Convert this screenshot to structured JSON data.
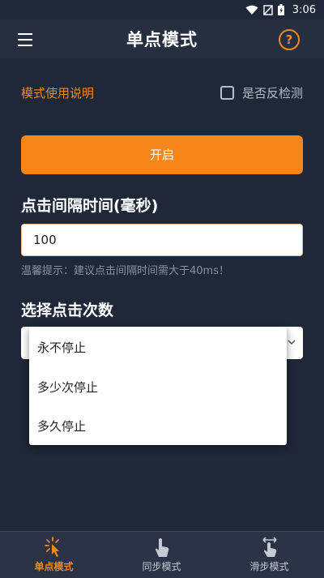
{
  "status_bar": {
    "time": "3:06"
  },
  "app_bar": {
    "title": "单点模式",
    "help_symbol": "?"
  },
  "mode_description_link": "模式使用说明",
  "reverse_detection": {
    "label": "是否反检测",
    "checked": false
  },
  "start_button": "开启",
  "click_interval": {
    "title": "点击间隔时间(毫秒)",
    "value": "100",
    "tip": "温馨提示：建议点击间隔时间需大于40ms！"
  },
  "click_count": {
    "title": "选择点击次数",
    "options": [
      "永不停止",
      "多少次停止",
      "多久停止"
    ]
  },
  "bottom_nav": {
    "items": [
      {
        "label": "单点模式",
        "icon": "tap-sparkle-icon",
        "active": true
      },
      {
        "label": "同步模式",
        "icon": "hand-pointer-icon",
        "active": false
      },
      {
        "label": "滑步模式",
        "icon": "swipe-hand-icon",
        "active": false
      }
    ]
  },
  "colors": {
    "background": "#1f2838",
    "app_bar": "#262f3f",
    "accent": "#f7861a",
    "nav_background": "#2a3446"
  }
}
